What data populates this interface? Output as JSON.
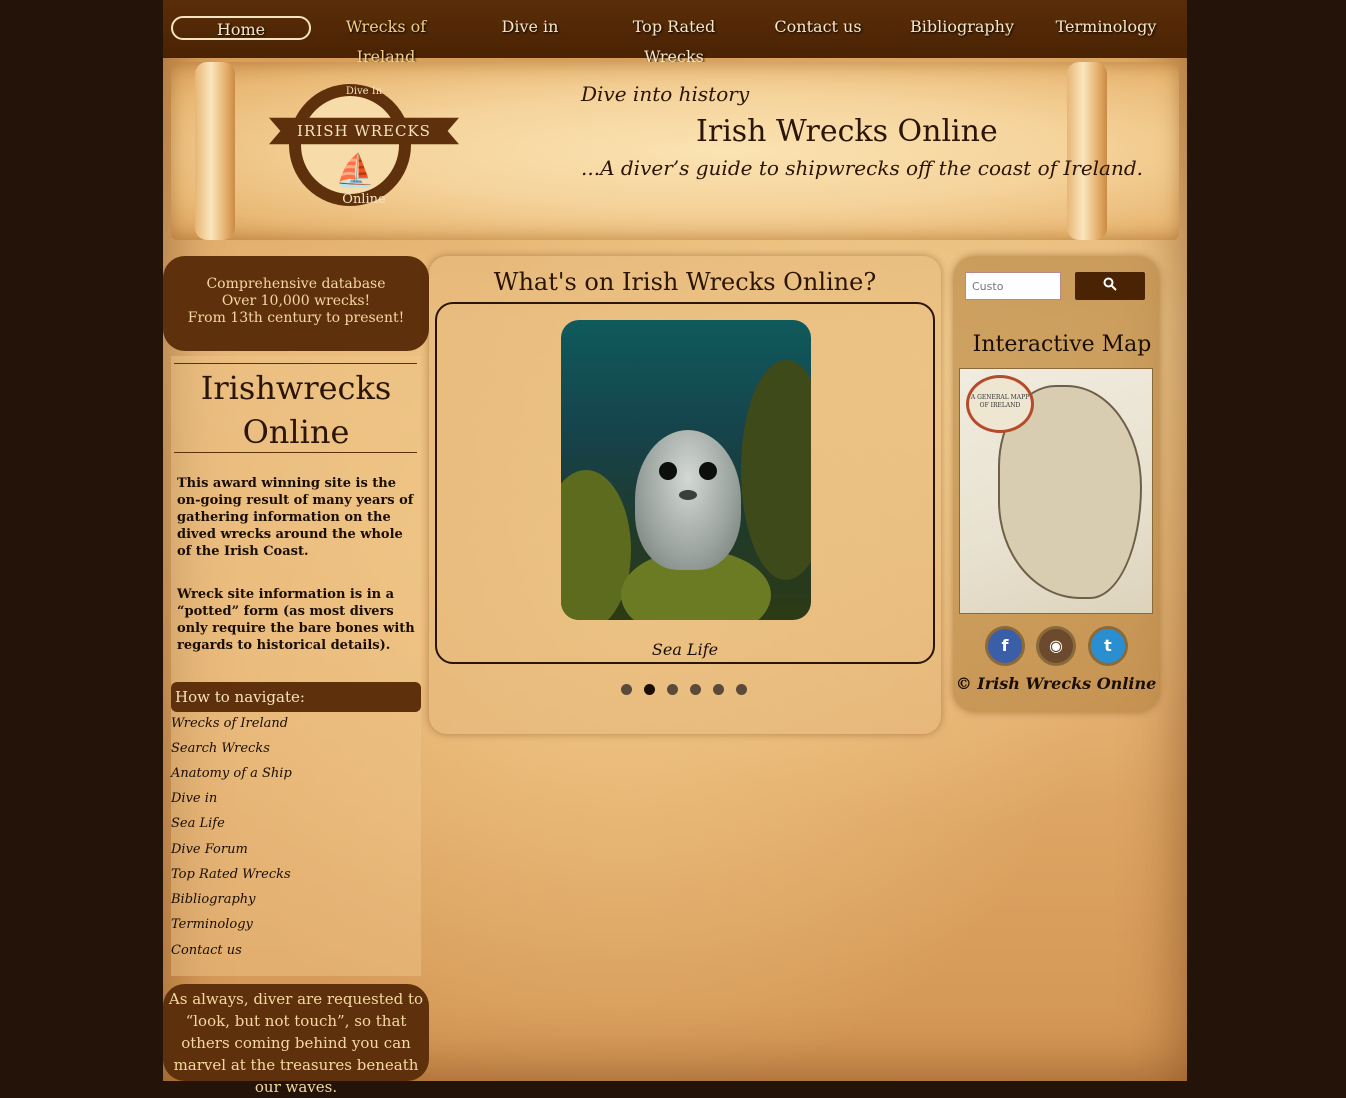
{
  "nav": {
    "items": [
      {
        "label": "Home"
      },
      {
        "label": "Wrecks of Ireland"
      },
      {
        "label": "Dive in"
      },
      {
        "label": "Top Rated Wrecks"
      },
      {
        "label": "Contact us"
      },
      {
        "label": "Bibliography"
      },
      {
        "label": "Terminology"
      }
    ]
  },
  "banner": {
    "logo_top": "Dive In",
    "logo_main": "IRISH WRECKS",
    "logo_bottom": "Online",
    "tagline1": "Dive into history",
    "title": "Irish Wrecks Online",
    "tagline2": "...A diver’s guide to shipwrecks off the coast of Ireland."
  },
  "left": {
    "db_line1": "Comprehensive database",
    "db_line2": "Over 10,000 wrecks!",
    "db_line3": "From 13th century to present!",
    "site_title_line1": "Irishwrecks",
    "site_title_line2": "Online",
    "para1": "This award winning site is the on-going result of many years of gathering information on the dived wrecks around the whole of the Irish Coast.",
    "para2": "Wreck site information is in a “potted” form (as most divers only require the bare bones with regards to historical details).",
    "howto_label": "How to navigate:",
    "links": [
      {
        "label": "Wrecks of Ireland"
      },
      {
        "label": "Search Wrecks"
      },
      {
        "label": "Anatomy of a Ship"
      },
      {
        "label": "Dive in"
      },
      {
        "label": "Sea Life"
      },
      {
        "label": "Dive Forum"
      },
      {
        "label": "Top Rated Wrecks"
      },
      {
        "label": "Bibliography"
      },
      {
        "label": "Terminology"
      },
      {
        "label": "Contact us"
      }
    ],
    "note": "As always, diver are requested to “look, but not touch”, so that others coming behind you can marvel at the treasures beneath our waves."
  },
  "center": {
    "title": "What's on Irish Wrecks Online?",
    "slide_caption": "Sea Life",
    "slide_count": 6,
    "active_slide": 2
  },
  "right": {
    "search_placeholder": "Custo",
    "map_title": "Interactive Map",
    "map_cartouche": "A GENERAL MAPP OF IRELAND",
    "social": [
      {
        "name": "facebook-icon",
        "glyph": "f",
        "color": "#3b5ea8"
      },
      {
        "name": "instagram-icon",
        "glyph": "◉",
        "color": "#6b4a2e"
      },
      {
        "name": "twitter-icon",
        "glyph": "t",
        "color": "#2a8fd0"
      }
    ],
    "copyright": "© Irish Wrecks Online"
  },
  "colors": {
    "brown_dark": "#5e300c",
    "nav_text": "#f6e6c6",
    "nav_gold": "#f2cf86"
  }
}
